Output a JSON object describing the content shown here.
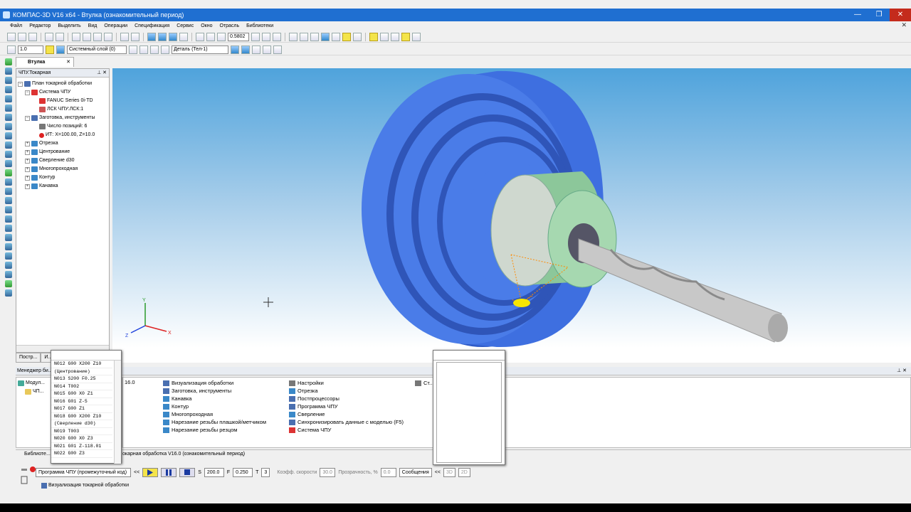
{
  "window": {
    "title": "КОМПАС-3D V16  x64 - Втулка (ознакомительный период)",
    "controls": [
      "—",
      "❐",
      "✕"
    ]
  },
  "menu": {
    "items": [
      "Файл",
      "Редактор",
      "Выделить",
      "Вид",
      "Операции",
      "Спецификация",
      "Сервис",
      "Окно",
      "Отрасль",
      "Библиотеки"
    ]
  },
  "toolbar1": {
    "zoom_value": "0.5802"
  },
  "toolbar2": {
    "scale_value": "1.0",
    "layer_value": "Системный слой (0)",
    "part_value": "Деталь (Тел-1)"
  },
  "document_tab": {
    "label": "Втулка",
    "close": "✕"
  },
  "tree_panel": {
    "title": "ЧПУ.Токарная",
    "pins": "⊥ ✕",
    "nodes": [
      {
        "label": "План токарной обработки"
      },
      {
        "label": "Система ЧПУ"
      },
      {
        "label": "FANUC Series 0i-TD"
      },
      {
        "label": "ЛСК ЧПУ:ЛСК:1"
      },
      {
        "label": "Заготовка, инструменты"
      },
      {
        "label": "Число позиций: 6"
      },
      {
        "label": "ИТ: X=100.00, Z=10.0"
      },
      {
        "label": "Отрезка"
      },
      {
        "label": "Центрование"
      },
      {
        "label": "Сверление d30"
      },
      {
        "label": "Многопроходная"
      },
      {
        "label": "Контур"
      },
      {
        "label": "Канавка"
      }
    ],
    "tabs": [
      "Постр...",
      "И..."
    ]
  },
  "viewport": {
    "axes": {
      "x": "X",
      "y": "Y",
      "z": "Z"
    }
  },
  "manager": {
    "title": "Менеджер би...",
    "pins": "⊥ ✕",
    "tree": [
      "Модул...",
      "ЧП..."
    ],
    "version_label": "16.0",
    "col1": [
      "Визуализация обработки",
      "Заготовка, инструменты",
      "Канавка",
      "Контур",
      "Многопроходная",
      "Нарезание резьбы плашкой/метчиком",
      "Нарезание резьбы резцом"
    ],
    "col2": [
      "Настройки",
      "Отрезка",
      "Постпроцессоры",
      "Программа ЧПУ",
      "Сверление",
      "Синхронизировать данные с моделью (F5)",
      "Система ЧПУ"
    ],
    "col3": [
      "Ст..."
    ]
  },
  "nc_popup": {
    "lines": [
      "N012 G00 X200 Z10",
      "(Центрование)",
      "N013 S200 F0.25",
      "N014 T002",
      "N015 G00 X0 Z1",
      "N016 G01 Z-5",
      "N017 G00 Z1",
      "N018 G00 X200 Z10",
      "(Сверление d30)",
      "N019 T003",
      "N020 G00 X0 Z3",
      "N021 G01 Z-118.01",
      "N022 G00 Z3"
    ]
  },
  "status": {
    "library_tab": "Библиоте...",
    "library_text": "окарная обработка V16.0 (ознакомительный период)"
  },
  "controls": {
    "program_label": "Программа ЧПУ (промежуточный код)",
    "collapse": "<<",
    "s_label": "S",
    "s_value": "200.0",
    "f_label": "F",
    "f_value": "0.250",
    "t_label": "T",
    "t_value": "3",
    "speed_label": "Коэфф. скорости",
    "speed_value": "30.0",
    "transparency_label": "Прозрачность, %",
    "transparency_value": "0.0",
    "messages_label": "Сообщения",
    "messages_collapse": "<<",
    "view_buttons": [
      "3D",
      "2D"
    ]
  },
  "bottom": {
    "visualization_tab": "Визуализация токарной обработки"
  },
  "colors": {
    "title_blue": "#1f6fd1",
    "part_blue": "#3e6fe0",
    "holder_green": "#a6d8b0",
    "tool_grey": "#c8c8c8"
  }
}
